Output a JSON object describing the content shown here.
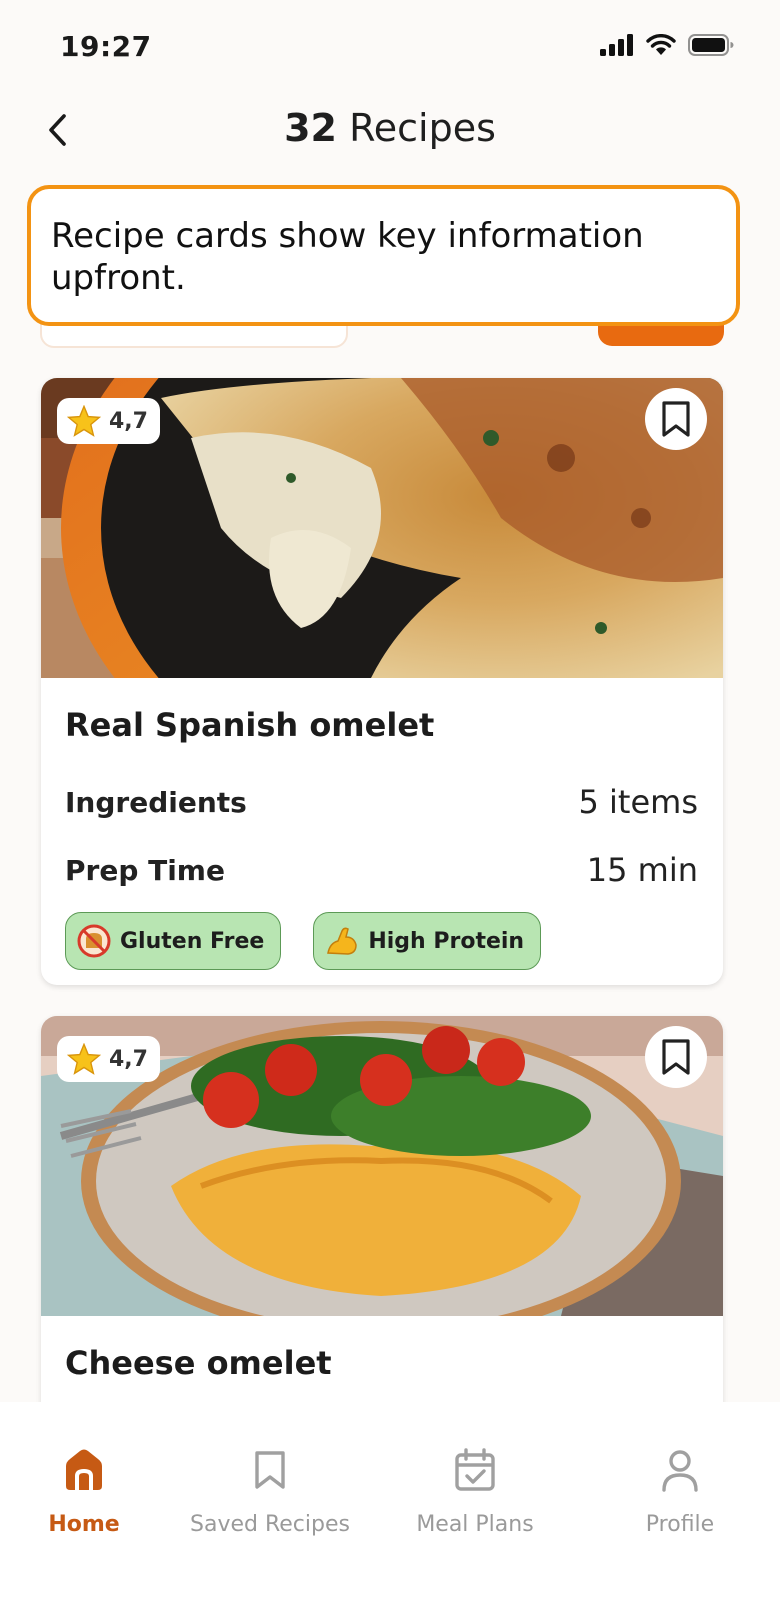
{
  "status_bar": {
    "time": "19:27"
  },
  "header": {
    "back_icon": "chevron-left-icon",
    "count": "32",
    "title_suffix": " Recipes"
  },
  "callout": {
    "text": "Recipe cards show key information upfront."
  },
  "recipes": [
    {
      "title": "Real Spanish omelet",
      "rating": "4,7",
      "ingredients_label": "Ingredients",
      "ingredients_value": "5 items",
      "prep_label": "Prep Time",
      "prep_value": "15 min",
      "tags": [
        {
          "label": "Gluten Free",
          "icon": "no-bread-icon"
        },
        {
          "label": "High Protein",
          "icon": "flexed-arm-icon"
        }
      ]
    },
    {
      "title": "Cheese omelet",
      "rating": "4,7"
    }
  ],
  "bottom_nav": {
    "items": [
      {
        "label": "Home",
        "icon": "home-icon",
        "active": true
      },
      {
        "label": "Saved Recipes",
        "icon": "bookmark-icon",
        "active": false
      },
      {
        "label": "Meal Plans",
        "icon": "calendar-check-icon",
        "active": false
      },
      {
        "label": "Profile",
        "icon": "person-icon",
        "active": false
      }
    ]
  },
  "colors": {
    "accent": "#e86a10",
    "callout_border": "#f39313",
    "tag_bg": "#b8e5b2",
    "nav_active": "#c65a14"
  }
}
